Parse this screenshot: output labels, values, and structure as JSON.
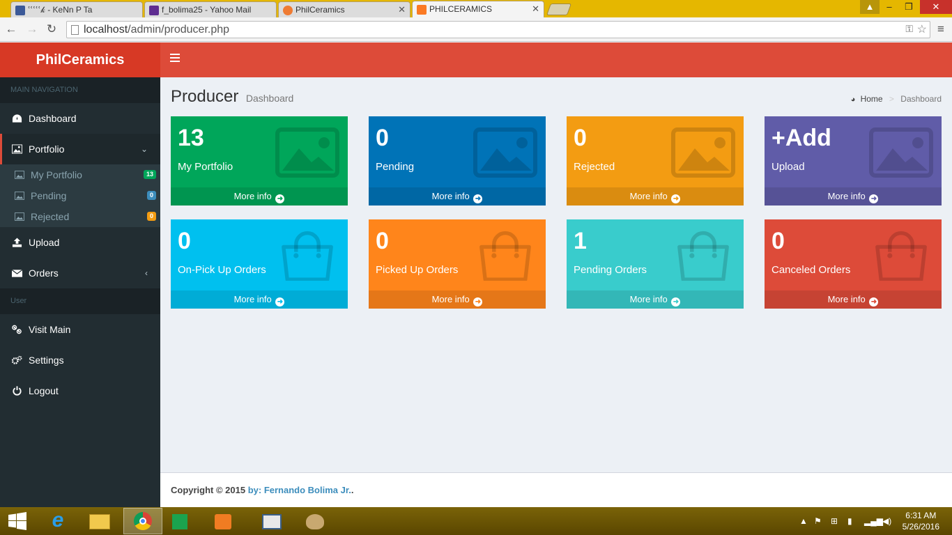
{
  "browser": {
    "tabs": [
      {
        "title": "ՙՙՙՙՙ𝓀 - KeNn P Ta",
        "color": "#3b5998"
      },
      {
        "title": "f_bolima25 - Yahoo Mail",
        "color": "#5f2d91"
      },
      {
        "title": "PhilCeramics",
        "color": "#ef7b33"
      },
      {
        "title": "PHILCERAMICS",
        "color": "#fb7a24"
      }
    ],
    "url_host": "localhost",
    "url_path": "/admin/producer.php"
  },
  "app": {
    "logo": "PhilCeramics"
  },
  "sidebar": {
    "main_header": "MAIN NAVIGATION",
    "user_header": "User",
    "items": {
      "dashboard": "Dashboard",
      "portfolio": "Portfolio",
      "upload": "Upload",
      "orders": "Orders",
      "visit_main": "Visit Main",
      "settings": "Settings",
      "logout": "Logout"
    },
    "portfolio_sub": [
      {
        "label": "My Portfolio",
        "badge": "13",
        "badge_color": "#00a65a"
      },
      {
        "label": "Pending",
        "badge": "0",
        "badge_color": "#3c8dbc"
      },
      {
        "label": "Rejected",
        "badge": "0",
        "badge_color": "#f39c12"
      }
    ]
  },
  "header": {
    "title": "Producer",
    "subtitle": "Dashboard",
    "breadcrumb_home": "Home",
    "breadcrumb_current": "Dashboard"
  },
  "boxes": [
    {
      "value": "13",
      "label": "My Portfolio",
      "more": "More info",
      "color": "#00a65a",
      "icon": "image-icon"
    },
    {
      "value": "0",
      "label": "Pending",
      "more": "More info",
      "color": "#0073b7",
      "icon": "image-icon"
    },
    {
      "value": "0",
      "label": "Rejected",
      "more": "More info",
      "color": "#f39c12",
      "icon": "image-icon"
    },
    {
      "value": "+Add",
      "label": "Upload",
      "more": "More info",
      "color": "#605ca8",
      "icon": "image-icon"
    },
    {
      "value": "0",
      "label": "On-Pick Up Orders",
      "more": "More info",
      "color": "#00c0ef",
      "icon": "shopping-bag-icon"
    },
    {
      "value": "0",
      "label": "Picked Up Orders",
      "more": "More info",
      "color": "#ff851b",
      "icon": "shopping-bag-icon"
    },
    {
      "value": "1",
      "label": "Pending Orders",
      "more": "More info",
      "color": "#39cccc",
      "icon": "shopping-bag-icon"
    },
    {
      "value": "0",
      "label": "Canceled Orders",
      "more": "More info",
      "color": "#dd4b39",
      "icon": "shopping-bag-icon"
    }
  ],
  "footer": {
    "copyright": "Copyright © 2015 ",
    "author": "by: Fernando Bolima Jr.",
    "suffix": "."
  },
  "taskbar": {
    "time": "6:31 AM",
    "date": "5/26/2016"
  }
}
